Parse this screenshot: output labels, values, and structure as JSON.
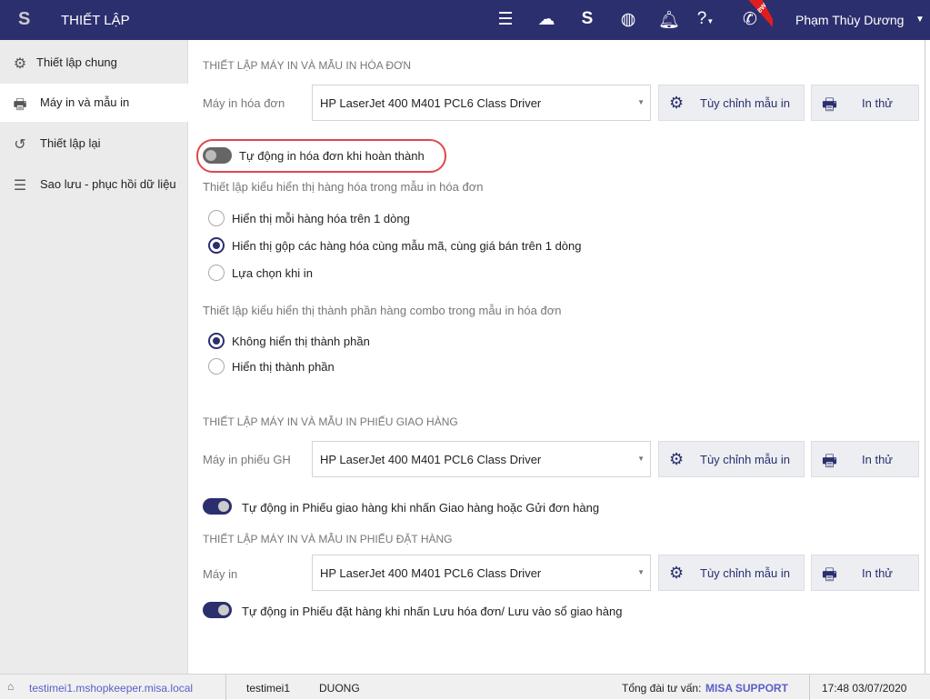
{
  "header": {
    "title": "THIẾT LẬP",
    "user": "Phạm Thùy Dương",
    "new_badge": "New",
    "icons": [
      "menu-icon",
      "cloud-sync-icon",
      "s-app-icon",
      "globe-icon",
      "bell-icon",
      "help-icon",
      "phone-icon"
    ]
  },
  "sidebar": {
    "items": [
      {
        "label": "Thiết lập chung",
        "icon": "gear-icon"
      },
      {
        "label": "Máy in và mẫu in",
        "icon": "printer-icon"
      },
      {
        "label": "Thiết lập lại",
        "icon": "reset-icon"
      },
      {
        "label": "Sao lưu - phục hồi dữ liệu",
        "icon": "database-icon"
      }
    ]
  },
  "invoice": {
    "title": "THIẾT LẬP MÁY IN VÀ MẪU IN HÓA ĐƠN",
    "printer_label": "Máy in hóa đơn",
    "printer": "HP LaserJet 400 M401 PCL6 Class Driver",
    "customize": "Tùy chỉnh mẫu in",
    "test": "In thử",
    "auto_print": "Tự động in hóa đơn khi hoàn thành",
    "auto_print_on": false,
    "display_title": "Thiết lập kiểu hiển thị hàng hóa trong mẫu in hóa đơn",
    "display_options": [
      "Hiển thị mỗi hàng hóa trên 1 dòng",
      "Hiển thị gộp các hàng hóa cùng mẫu mã, cùng giá bán trên 1 dòng",
      "Lựa chọn khi in"
    ],
    "display_selected": 1,
    "combo_title": "Thiết lập kiểu hiển thị thành phần hàng combo trong mẫu in hóa đơn",
    "combo_options": [
      "Không hiển thị thành phần",
      "Hiển thị thành phần"
    ],
    "combo_selected": 0
  },
  "delivery": {
    "title": "THIẾT LẬP MÁY IN VÀ MẪU IN PHIẾU GIAO HÀNG",
    "printer_label": "Máy in phiếu GH",
    "printer": "HP LaserJet 400 M401 PCL6 Class Driver",
    "customize": "Tùy chỉnh mẫu in",
    "test": "In thử",
    "auto_print": "Tự động in Phiếu giao hàng khi nhấn Giao hàng hoặc Gửi đơn hàng",
    "auto_print_on": true
  },
  "order": {
    "title": "THIẾT LẬP MÁY IN VÀ MẪU IN PHIẾU ĐẶT HÀNG",
    "printer_label": "Máy in",
    "printer": "HP LaserJet 400 M401 PCL6 Class Driver",
    "customize": "Tùy chỉnh mẫu in",
    "test": "In thử",
    "auto_print": "Tự động in Phiếu đặt hàng khi nhấn Lưu hóa đơn/ Lưu vào sổ giao hàng",
    "auto_print_on": true
  },
  "status": {
    "domain": "testimei1.mshopkeeper.misa.local",
    "account": "testimei1",
    "user": "DUONG",
    "hotline_label": "Tổng đài tư vấn:",
    "hotline": "MISA SUPPORT",
    "datetime": "17:48 03/07/2020"
  },
  "colors": {
    "header": "#2c2f6e",
    "accent": "#2c2f6e",
    "highlight": "#e0474c"
  }
}
